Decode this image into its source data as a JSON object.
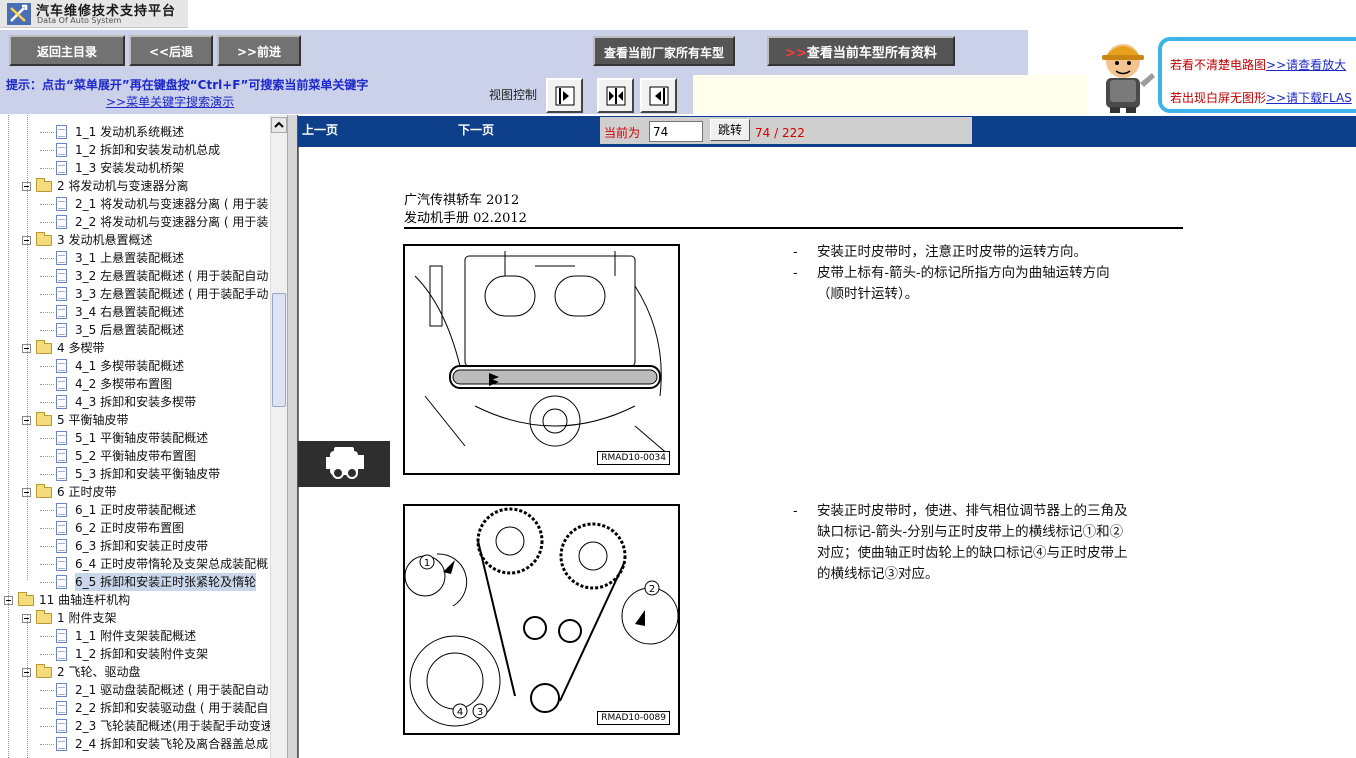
{
  "app": {
    "title": "汽车维修技术支持平台",
    "subtitle": "Data Of Auto System"
  },
  "nav": {
    "home": "返回主目录",
    "back": "<<后退",
    "forward": ">>前进",
    "models": "查看当前厂家所有车型",
    "all_info_prefix": ">>",
    "all_info": "查看当前车型所有资料"
  },
  "hint": {
    "text": "提示：点击“菜单展开”再在键盘按“Ctrl+F”可搜索当前菜单关键字",
    "link": ">>菜单关键字搜索演示",
    "view_control": "视图控制"
  },
  "notice": {
    "line1_text": "若看不清楚电路图",
    "line1_link": ">>请查看放大",
    "line2_text": "若出现白屏无图形",
    "line2_link": ">>请下载FLAS"
  },
  "tree": [
    {
      "level": 3,
      "type": "doc",
      "label": "1_1 发动机系统概述"
    },
    {
      "level": 3,
      "type": "doc",
      "label": "1_2 拆卸和安装发动机总成"
    },
    {
      "level": 3,
      "type": "doc",
      "label": "1_3 安装发动机桥架"
    },
    {
      "level": 2,
      "type": "folder",
      "label": "2 将发动机与变速器分离"
    },
    {
      "level": 3,
      "type": "doc",
      "label": "2_1 将发动机与变速器分离 ( 用于装"
    },
    {
      "level": 3,
      "type": "doc",
      "label": "2_2 将发动机与变速器分离 ( 用于装"
    },
    {
      "level": 2,
      "type": "folder",
      "label": "3 发动机悬置概述"
    },
    {
      "level": 3,
      "type": "doc",
      "label": "3_1 上悬置装配概述"
    },
    {
      "level": 3,
      "type": "doc",
      "label": "3_2 左悬置装配概述 ( 用于装配自动"
    },
    {
      "level": 3,
      "type": "doc",
      "label": "3_3 左悬置装配概述 ( 用于装配手动"
    },
    {
      "level": 3,
      "type": "doc",
      "label": "3_4 右悬置装配概述"
    },
    {
      "level": 3,
      "type": "doc",
      "label": "3_5 后悬置装配概述"
    },
    {
      "level": 2,
      "type": "folder",
      "label": "4 多楔带"
    },
    {
      "level": 3,
      "type": "doc",
      "label": "4_1 多楔带装配概述"
    },
    {
      "level": 3,
      "type": "doc",
      "label": "4_2 多楔带布置图"
    },
    {
      "level": 3,
      "type": "doc",
      "label": "4_3 拆卸和安装多楔带"
    },
    {
      "level": 2,
      "type": "folder",
      "label": "5 平衡轴皮带"
    },
    {
      "level": 3,
      "type": "doc",
      "label": "5_1 平衡轴皮带装配概述"
    },
    {
      "level": 3,
      "type": "doc",
      "label": "5_2 平衡轴皮带布置图"
    },
    {
      "level": 3,
      "type": "doc",
      "label": "5_3 拆卸和安装平衡轴皮带"
    },
    {
      "level": 2,
      "type": "folder",
      "label": "6 正时皮带"
    },
    {
      "level": 3,
      "type": "doc",
      "label": "6_1 正时皮带装配概述"
    },
    {
      "level": 3,
      "type": "doc",
      "label": "6_2 正时皮带布置图"
    },
    {
      "level": 3,
      "type": "doc",
      "label": "6_3 拆卸和安装正时皮带"
    },
    {
      "level": 3,
      "type": "doc",
      "label": "6_4 正时皮带惰轮及支架总成装配概"
    },
    {
      "level": 3,
      "type": "doc",
      "label": "6_5 拆卸和安装正时张紧轮及惰轮",
      "selected": true
    },
    {
      "level": 1,
      "type": "folder",
      "label": "11 曲轴连杆机构"
    },
    {
      "level": 2,
      "type": "folder",
      "label": "1 附件支架"
    },
    {
      "level": 3,
      "type": "doc",
      "label": "1_1 附件支架装配概述"
    },
    {
      "level": 3,
      "type": "doc",
      "label": "1_2 拆卸和安装附件支架"
    },
    {
      "level": 2,
      "type": "folder",
      "label": "2 飞轮、驱动盘"
    },
    {
      "level": 3,
      "type": "doc",
      "label": "2_1 驱动盘装配概述 ( 用于装配自动"
    },
    {
      "level": 3,
      "type": "doc",
      "label": "2_2 拆卸和安装驱动盘 ( 用于装配自"
    },
    {
      "level": 3,
      "type": "doc",
      "label": "2_3 飞轮装配概述(用于装配手动变速"
    },
    {
      "level": 3,
      "type": "doc",
      "label": "2_4 拆卸和安装飞轮及离合器盖总成"
    }
  ],
  "pager": {
    "prev": "上一页",
    "next": "下一页",
    "current_label": "当前为",
    "current_value": "74",
    "jump": "跳转",
    "count": "74 / 222"
  },
  "document": {
    "header1": "广汽传祺轿车 2012",
    "header2": "发动机手册 02.2012",
    "figure1_code": "RMAD10-0034",
    "figure2_code": "RMAD10-0089",
    "dash": "-",
    "steps1": [
      "安装正时皮带时，注意正时皮带的运转方向。",
      "皮带上标有-箭头-的标记所指方向为曲轴运转方向",
      "（顺时针运转）。"
    ],
    "steps2": [
      "安装正时皮带时，使进、排气相位调节器上的三角及",
      "缺口标记-箭头-分别与正时皮带上的横线标记①和②",
      "对应；使曲轴正时齿轮上的缺口标记④与正时皮带上",
      "的横线标记③对应。"
    ]
  }
}
